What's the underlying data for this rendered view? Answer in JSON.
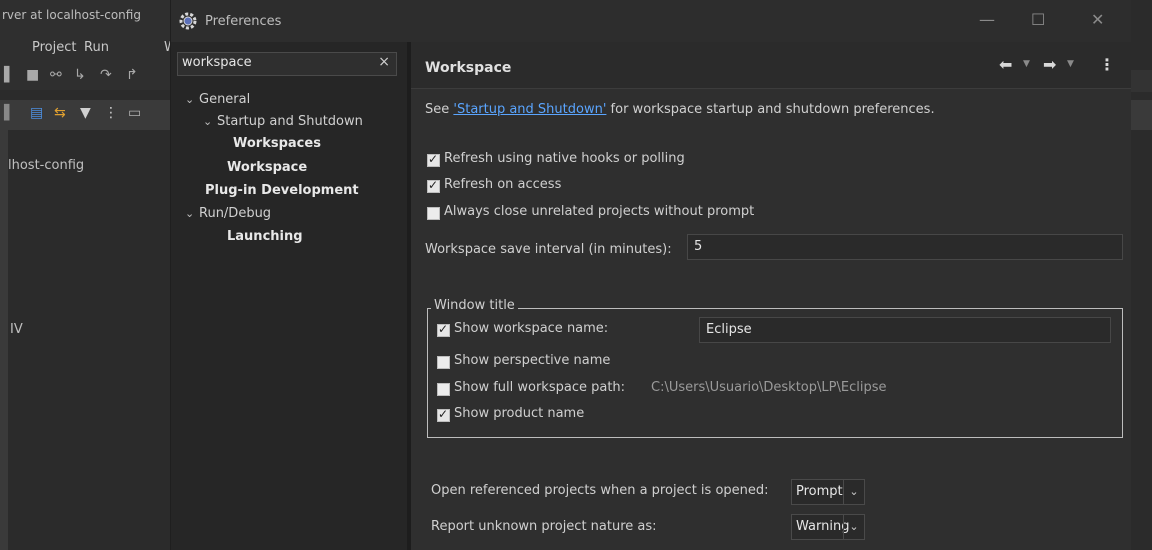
{
  "ide": {
    "window_title": "rver at localhost-config",
    "menu": [
      "Project",
      "Run",
      "W"
    ],
    "server_label": "lhost-config",
    "panel_text": "IV"
  },
  "dialog": {
    "title": "Preferences",
    "controls": {
      "minimize": "—",
      "maximize": "☐",
      "close": "✕"
    }
  },
  "sidebar": {
    "filter_value": "workspace",
    "filter_clear": "×",
    "tree": [
      {
        "label": "General",
        "expanded": true
      },
      {
        "label": "Startup and Shutdown",
        "expanded": true
      },
      {
        "label": "Workspaces"
      },
      {
        "label": "Workspace",
        "selected": true
      },
      {
        "label": "Plug-in Development"
      },
      {
        "label": "Run/Debug",
        "expanded": true
      },
      {
        "label": "Launching"
      }
    ]
  },
  "page": {
    "title": "Workspace",
    "intro_prefix": "See ",
    "intro_link": "'Startup and Shutdown'",
    "intro_suffix": " for workspace startup and shutdown preferences.",
    "options": [
      {
        "label": "Refresh using native hooks or polling",
        "checked": true
      },
      {
        "label": "Refresh on access",
        "checked": true
      },
      {
        "label": "Always close unrelated projects without prompt",
        "checked": false
      }
    ],
    "save_interval": {
      "label": "Workspace save interval (in minutes):",
      "value": "5"
    },
    "window_title_group": {
      "label": "Window title",
      "items": [
        {
          "label": "Show workspace name:",
          "checked": true,
          "value": "Eclipse"
        },
        {
          "label": "Show perspective name",
          "checked": false
        },
        {
          "label": "Show full workspace path:",
          "checked": false,
          "value": "C:\\Users\\Usuario\\Desktop\\LP\\Eclipse"
        },
        {
          "label": "Show product name",
          "checked": true
        }
      ]
    },
    "open_referenced": {
      "label": "Open referenced projects when a project is opened:",
      "value": "Prompt"
    },
    "unknown_nature": {
      "label": "Report unknown project nature as:",
      "value": "Warning"
    }
  }
}
